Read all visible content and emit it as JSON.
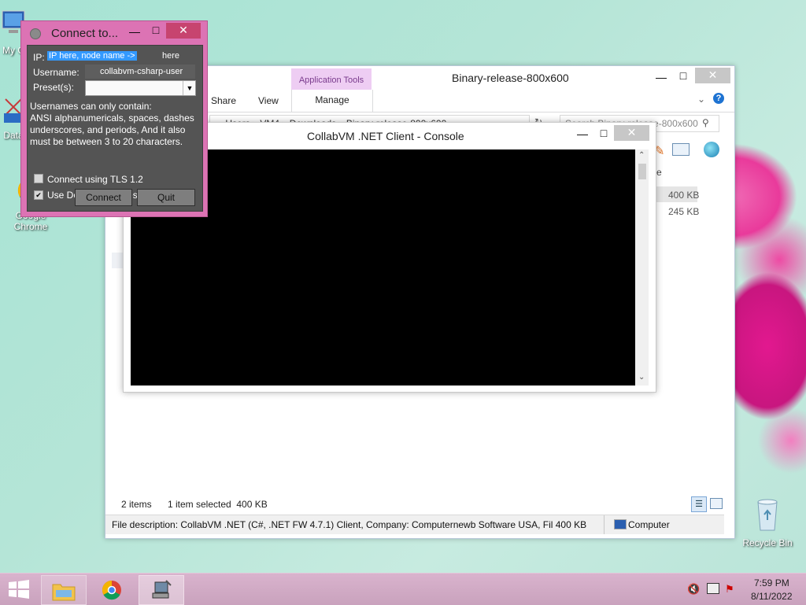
{
  "desktop": {
    "icons": [
      {
        "label": "My C",
        "icon": "computer-icon"
      },
      {
        "label": "Data",
        "icon": "data-icon"
      },
      {
        "label": "Google Chrome",
        "icon": "chrome-icon"
      },
      {
        "label": "Recycle Bin",
        "icon": "recycle-bin-icon"
      }
    ]
  },
  "explorer": {
    "title": "Binary-release-800x600",
    "contextual_tab_group": "Application Tools",
    "tabs": [
      "Share",
      "View",
      "Manage"
    ],
    "breadcrumb": [
      "«",
      "Users",
      "VM4",
      "Downloads",
      "Binary-release-800x600"
    ],
    "search_placeholder": "Search Binary-release-800x600",
    "column_partial": "e",
    "file_sizes": [
      "400 KB",
      "245 KB"
    ],
    "status": {
      "items": "2 items",
      "selected": "1 item selected  400 KB"
    },
    "details_bar": {
      "description": "File description: CollabVM .NET (C#, .NET FW 4.7.1) Client, Company: Computernewb Software USA, Fil 400 KB",
      "location": "Computer"
    }
  },
  "console": {
    "title": "CollabVM .NET Client - Console"
  },
  "connect_dialog": {
    "title": "Connect to...",
    "ip_label": "IP:",
    "ip_value": "IP here, node name ->",
    "node_value": "here",
    "username_label": "Username:",
    "username_value": "collabvm-csharp-user",
    "preset_label": "Preset(s):",
    "preset_value": "",
    "help_text": "Usernames can only contain:\nANSI alphanumericals, spaces, dashes underscores, and periods, And it also must be between 3 to 20 characters.",
    "tls_label": "Connect using TLS 1.2",
    "tls_checked": false,
    "deflate_label": "Use Deflate Compression",
    "deflate_checked": true,
    "connect_label": "Connect",
    "quit_label": "Quit"
  },
  "taskbar": {
    "time": "7:59 PM",
    "date": "8/11/2022"
  },
  "colors": {
    "dialog_frame": "#dc73b4",
    "dialog_body": "#545454",
    "selection": "#3399ff",
    "contextual_tab": "#eecdf3"
  }
}
